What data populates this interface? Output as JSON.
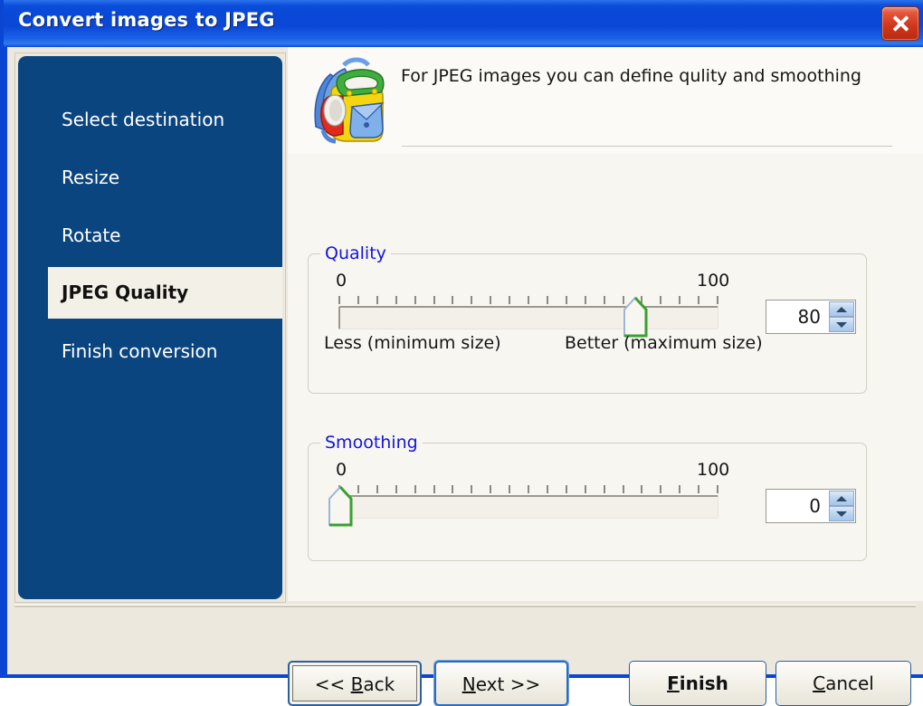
{
  "window": {
    "title": "Convert images to JPEG",
    "close_label": "Close",
    "close_icon": "close-icon",
    "accent_color": "#0a46d2",
    "titlebar_text_color": "#ffffff"
  },
  "sidebar": {
    "background_color": "#0b4580",
    "active_color": "#f3f0e7",
    "items": [
      {
        "label": "Select destination",
        "active": false
      },
      {
        "label": "Resize",
        "active": false
      },
      {
        "label": "Rotate",
        "active": false
      },
      {
        "label": "JPEG Quality",
        "active": true
      },
      {
        "label": "Finish conversion",
        "active": false
      }
    ]
  },
  "header": {
    "icon": "backpack-icon",
    "description": "For JPEG images you can define qulity and smoothing"
  },
  "quality": {
    "legend": "Quality",
    "legend_color": "#1414e0",
    "min_label": "0",
    "max_label": "100",
    "min_hint": "Less (minimum size)",
    "max_hint": "Better (maximum size)",
    "value": "80",
    "min": 0,
    "max": 100,
    "tick_count": 21,
    "spinner_up_icon": "chevron-up-icon",
    "spinner_down_icon": "chevron-down-icon"
  },
  "smoothing": {
    "legend": "Smoothing",
    "legend_color": "#1414e0",
    "min_label": "0",
    "max_label": "100",
    "value": "0",
    "min": 0,
    "max": 100,
    "tick_count": 21,
    "spinner_up_icon": "chevron-up-icon",
    "spinner_down_icon": "chevron-down-icon"
  },
  "footer": {
    "back_label": "<< Back",
    "next_label": "Next >>",
    "finish_label": "Finish",
    "cancel_label": "Cancel"
  }
}
